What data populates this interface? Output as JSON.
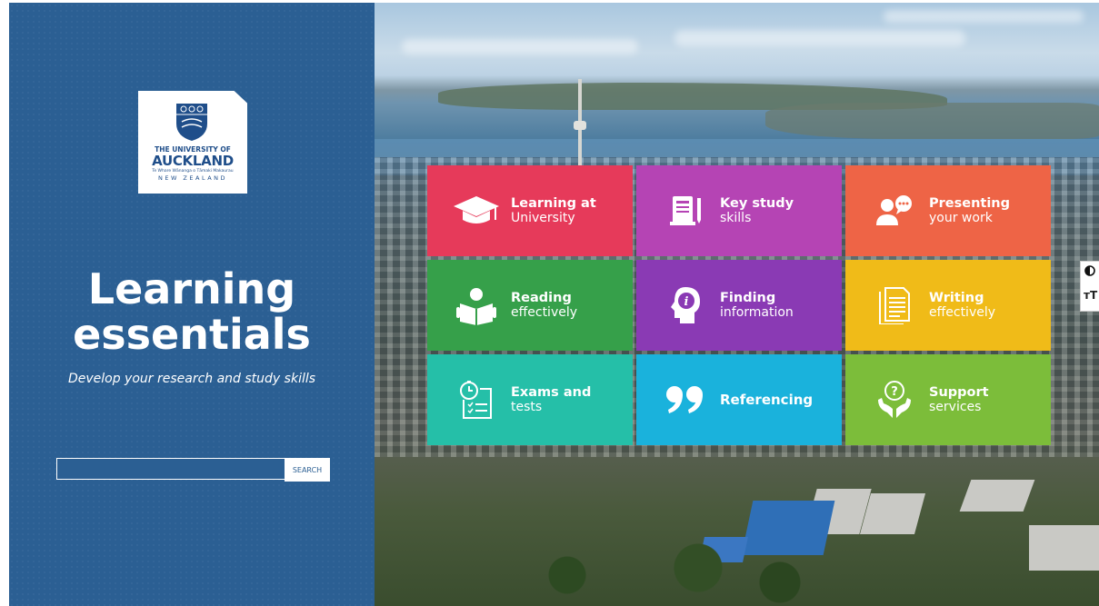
{
  "left_panel": {
    "logo": {
      "line1": "THE UNIVERSITY OF",
      "line2": "AUCKLAND",
      "line3": "Te Whare Wānanga o Tāmaki Makaurau",
      "line4": "NEW ZEALAND"
    },
    "title_line1": "Learning",
    "title_line2": "essentials",
    "subtitle": "Develop your research and study skills",
    "search": {
      "placeholder": "",
      "value": "",
      "button_label": "SEARCH"
    }
  },
  "tiles": [
    {
      "id": "learning-at-university",
      "title": "Learning at",
      "subtitle": "University",
      "color": "#e63a5a",
      "icon": "graduation-cap-icon"
    },
    {
      "id": "key-study-skills",
      "title": "Key study",
      "subtitle": "skills",
      "color": "#b544b4",
      "icon": "notebook-pencil-icon"
    },
    {
      "id": "presenting-your-work",
      "title": "Presenting",
      "subtitle": "your work",
      "color": "#ee6446",
      "icon": "presenter-speech-icon"
    },
    {
      "id": "reading-effectively",
      "title": "Reading",
      "subtitle": "effectively",
      "color": "#36a04a",
      "icon": "reader-book-icon"
    },
    {
      "id": "finding-information",
      "title": "Finding",
      "subtitle": "information",
      "color": "#8a3ab4",
      "icon": "head-info-icon"
    },
    {
      "id": "writing-effectively",
      "title": "Writing",
      "subtitle": "effectively",
      "color": "#f0bb18",
      "icon": "document-icon"
    },
    {
      "id": "exams-and-tests",
      "title": "Exams and",
      "subtitle": "tests",
      "color": "#25bfa8",
      "icon": "timer-checklist-icon"
    },
    {
      "id": "referencing",
      "title": "Referencing",
      "subtitle": "",
      "color": "#1ab2dc",
      "icon": "quote-marks-icon"
    },
    {
      "id": "support-services",
      "title": "Support",
      "subtitle": "services",
      "color": "#7cbd3a",
      "icon": "hands-question-icon"
    }
  ],
  "edge_toolbar": {
    "contrast_icon": "contrast-icon",
    "text_size_label": "тT"
  }
}
